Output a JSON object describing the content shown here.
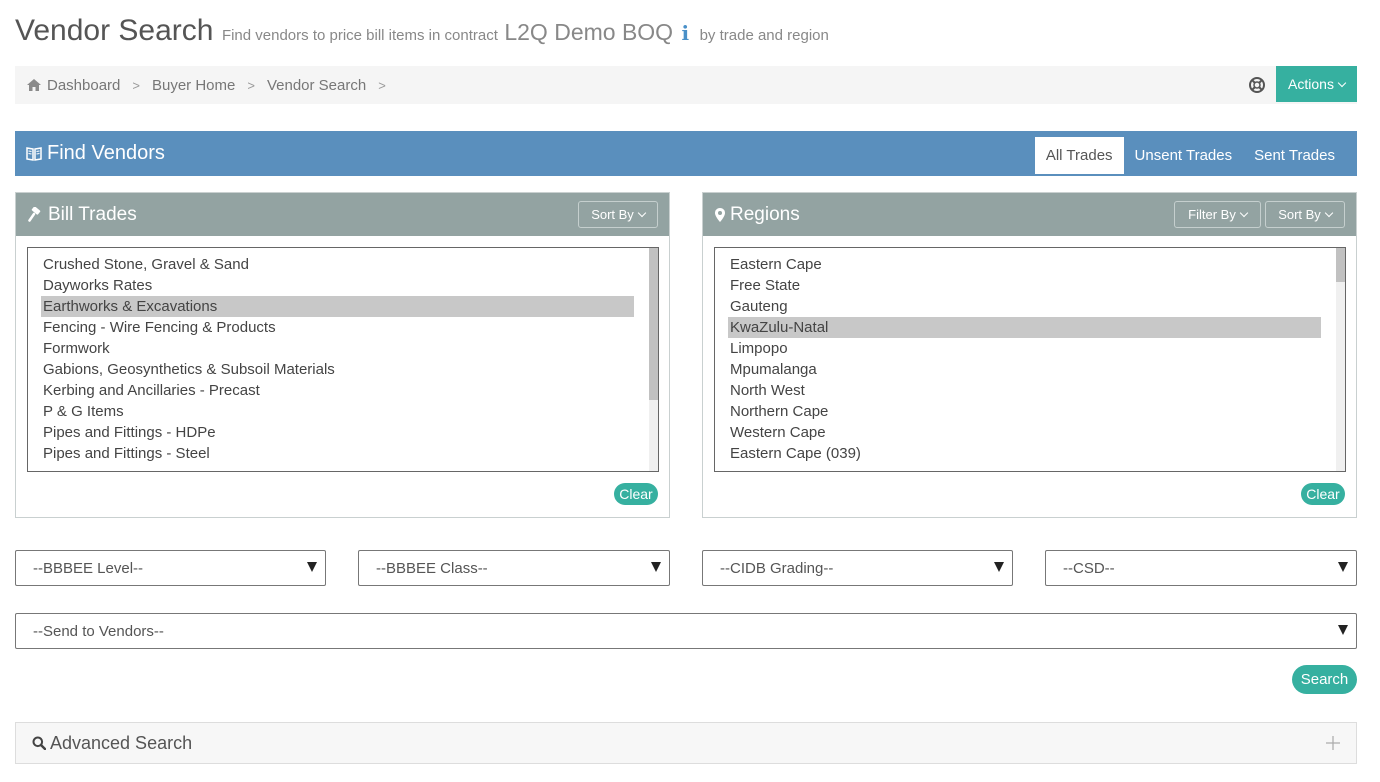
{
  "header": {
    "title": "Vendor Search",
    "subtitle": "Find vendors to price bill items in contract",
    "contract": "L2Q Demo BOQ",
    "info_glyph": "i",
    "suffix": "by trade and region"
  },
  "breadcrumb": {
    "items": [
      "Dashboard",
      "Buyer Home",
      "Vendor Search"
    ],
    "separator": ">",
    "actions_label": "Actions"
  },
  "find": {
    "title": "Find Vendors",
    "tabs": [
      "All Trades",
      "Unsent Trades",
      "Sent Trades"
    ],
    "active_tab": "All Trades"
  },
  "trades": {
    "title": "Bill Trades",
    "sort_label": "Sort By",
    "items": [
      "Crushed Stone, Gravel & Sand",
      "Dayworks Rates",
      "Earthworks & Excavations",
      "Fencing - Wire Fencing & Products",
      "Formwork",
      "Gabions, Geosynthetics & Subsoil Materials",
      "Kerbing and Ancillaries - Precast",
      "P & G Items",
      "Pipes and Fittings - HDPe",
      "Pipes and Fittings - Steel"
    ],
    "selected": "Earthworks & Excavations",
    "clear_label": "Clear"
  },
  "regions": {
    "title": "Regions",
    "filter_label": "Filter By",
    "sort_label": "Sort By",
    "items": [
      "Eastern Cape",
      "Free State",
      "Gauteng",
      "KwaZulu-Natal",
      "Limpopo",
      "Mpumalanga",
      "North West",
      "Northern Cape",
      "Western Cape",
      "Eastern Cape (039)"
    ],
    "selected": "KwaZulu-Natal",
    "clear_label": "Clear"
  },
  "filters": {
    "bbbee_level": "--BBBEE Level--",
    "bbbee_class": "--BBBEE Class--",
    "cidb_grading": "--CIDB Grading--",
    "csd": "--CSD--",
    "send_to": "--Send to Vendors--"
  },
  "search_label": "Search",
  "advanced": {
    "title": "Advanced Search"
  },
  "colors": {
    "accent": "#36b0a0",
    "header_blue": "#5a8fbd",
    "panel_gray": "#93a3a2"
  },
  "icons": [
    "home-icon",
    "help-icon",
    "book-icon",
    "hammer-icon",
    "map-marker-icon",
    "search-icon",
    "plus-icon",
    "info-icon"
  ]
}
